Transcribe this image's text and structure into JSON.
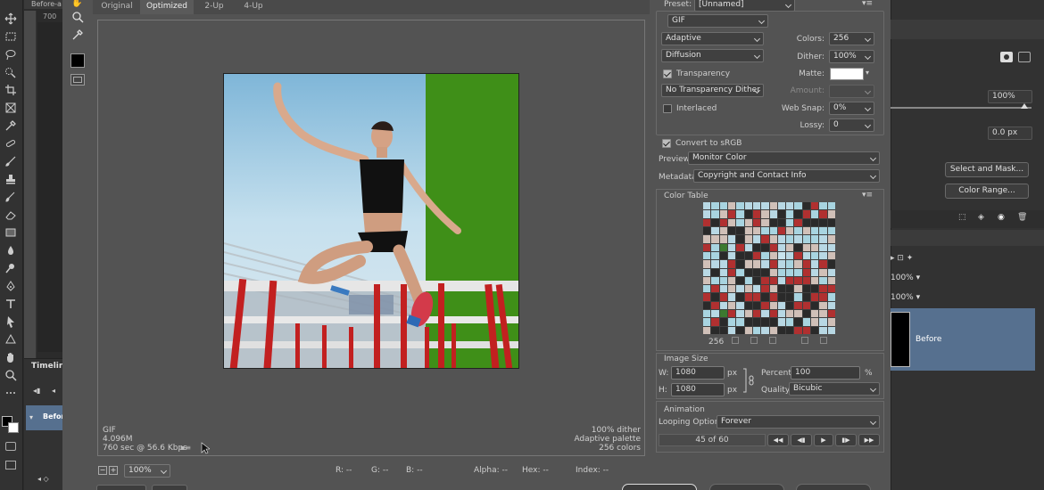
{
  "doc_tab": {
    "label": "Before-a"
  },
  "ruler": {
    "mark": "700"
  },
  "tabs": [
    {
      "label": "Original"
    },
    {
      "label": "Optimized"
    },
    {
      "label": "2-Up"
    },
    {
      "label": "4-Up"
    }
  ],
  "image_info": {
    "left": [
      "GIF",
      "4.096M",
      "760 sec @ 56.6 Kbps"
    ],
    "right": [
      "100% dither",
      "Adaptive palette",
      "256 colors"
    ]
  },
  "statusbar": {
    "zoom": "100%",
    "r": "R: --",
    "g": "G: --",
    "b": "B: --",
    "alpha": "Alpha: --",
    "hex": "Hex: --",
    "index": "Index: --"
  },
  "settings": {
    "preset_label": "Preset:",
    "preset_value": "[Unnamed]",
    "format": "GIF",
    "reduction": "Adaptive",
    "dither_algo": "Diffusion",
    "colors_label": "Colors:",
    "colors_value": "256",
    "dither_label": "Dither:",
    "dither_value": "100%",
    "transparency_label": "Transparency",
    "matte_label": "Matte:",
    "trans_dither": "No Transparency Dither",
    "amount_label": "Amount:",
    "interlaced_label": "Interlaced",
    "websnap_label": "Web Snap:",
    "websnap_value": "0%",
    "lossy_label": "Lossy:",
    "lossy_value": "0",
    "srgb_label": "Convert to sRGB",
    "preview_label": "Preview:",
    "preview_value": "Monitor Color",
    "metadata_label": "Metadata:",
    "metadata_value": "Copyright and Contact Info"
  },
  "color_table": {
    "title": "Color Table",
    "count": "256",
    "colors": [
      "#a8d4e0",
      "#c8e4ee",
      "#3a8a2a",
      "#d8e8ec",
      "#b03030",
      "#5a9a48",
      "#e0e8e4",
      "#7ab8d0",
      "#2a2a2a",
      "#c0dce8",
      "#4a4a4a",
      "#90c0d4",
      "#d0c0b8",
      "#3c7a30",
      "#e8f0f4",
      "#6a6a6a",
      "#b8d8e4",
      "#8a2a2a",
      "#9ac8da",
      "#404040"
    ]
  },
  "image_size": {
    "title": "Image Size",
    "w_label": "W:",
    "w_value": "1080",
    "h_label": "H:",
    "h_value": "1080",
    "unit": "px",
    "percent_label": "Percent:",
    "percent_value": "100",
    "percent_unit": "%",
    "quality_label": "Quality:",
    "quality_value": "Bicubic"
  },
  "animation": {
    "title": "Animation",
    "looping_label": "Looping Options:",
    "looping_value": "Forever",
    "frame": "45 of 60"
  },
  "right_panel": {
    "opacity": "100%",
    "feather": "0.0 px",
    "select_mask": "Select and Mask...",
    "color_range": "Color Range...",
    "opacity2": "100%",
    "fill": "100%",
    "layer_name": "Before"
  },
  "timeline": {
    "label": "Timeline",
    "layer": "Before"
  }
}
